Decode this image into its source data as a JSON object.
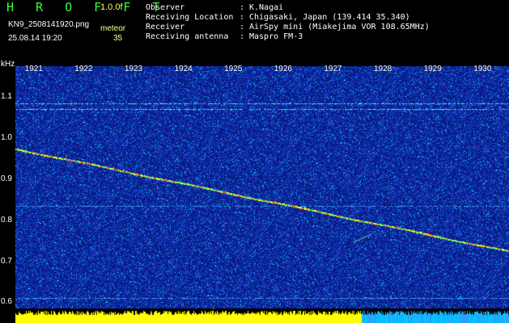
{
  "header": {
    "app_title": "H R O F F T",
    "version": "1.0.0f",
    "filename": "KN9_2508141920.png",
    "datetime": "25.08.14 19:20",
    "meteor_label": "meteor",
    "meteor_count": "35"
  },
  "metadata": [
    {
      "key": "Observer",
      "sep": ":",
      "value": "K.Nagai"
    },
    {
      "key": "Receiving Location",
      "sep": ":",
      "value": "Chigasaki, Japan (139.414 35.340)"
    },
    {
      "key": "Receiver",
      "sep": ":",
      "value": "AirSpy mini (Miakejima VOR 108.65MHz)"
    },
    {
      "key": "Receiving antenna",
      "sep": ":",
      "value": "Maspro FM-3"
    }
  ],
  "spectrogram": {
    "y_unit": "kHz",
    "y_ticks": [
      "1.1",
      "1.0",
      "0.9",
      "0.8",
      "0.7",
      "0.6"
    ],
    "y_tick_values": [
      1.1,
      1.0,
      0.9,
      0.8,
      0.7,
      0.6
    ],
    "x_ticks": [
      "1921",
      "1922",
      "1923",
      "1924",
      "1925",
      "1926",
      "1927",
      "1928",
      "1929",
      "1930"
    ],
    "y_range_khz": [
      0.585,
      1.175
    ],
    "x_range_minutes": [
      1920.6,
      1930.5
    ],
    "colors": {
      "background": "#0a1f8c",
      "noise_mid": "#2a7fff",
      "noise_high": "#00ffff",
      "hot": "#ffff00",
      "signal_peak": "#ff3333",
      "level_bar": "#ffff00",
      "level_bar_alt": "#00c8ff"
    },
    "carrier_lines_khz": [
      1.085,
      1.07,
      0.835,
      0.61
    ],
    "doppler_trace": {
      "start": {
        "minute": 1920.6,
        "khz": 0.975
      },
      "end": {
        "minute": 1930.5,
        "khz": 0.725
      }
    }
  }
}
